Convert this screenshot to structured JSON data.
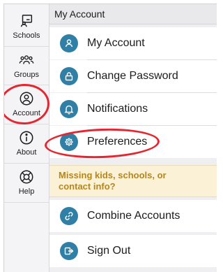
{
  "sidebar": {
    "items": [
      {
        "label": "Schools",
        "icon": "schools-icon"
      },
      {
        "label": "Groups",
        "icon": "groups-icon"
      },
      {
        "label": "Account",
        "icon": "account-icon",
        "selected": true
      },
      {
        "label": "About",
        "icon": "info-icon"
      },
      {
        "label": "Help",
        "icon": "lifebuoy-icon"
      }
    ]
  },
  "main": {
    "section_title": "My Account",
    "menu": [
      {
        "label": "My Account",
        "icon": "person-icon"
      },
      {
        "label": "Change Password",
        "icon": "lock-icon"
      },
      {
        "label": "Notifications",
        "icon": "bell-icon"
      },
      {
        "label": "Preferences",
        "icon": "gear-icon"
      }
    ],
    "notice": {
      "line1": "Missing kids, schools, or",
      "line2": "contact info?"
    },
    "combine": {
      "label": "Combine Accounts",
      "icon": "link-icon"
    },
    "signout": {
      "label": "Sign Out",
      "icon": "sign-out-icon"
    }
  },
  "colors": {
    "accent_badge": "#2f7fa6",
    "annotation_red": "#e52630",
    "notice_text": "#b5861b",
    "notice_bg": "#fbf1d6"
  }
}
